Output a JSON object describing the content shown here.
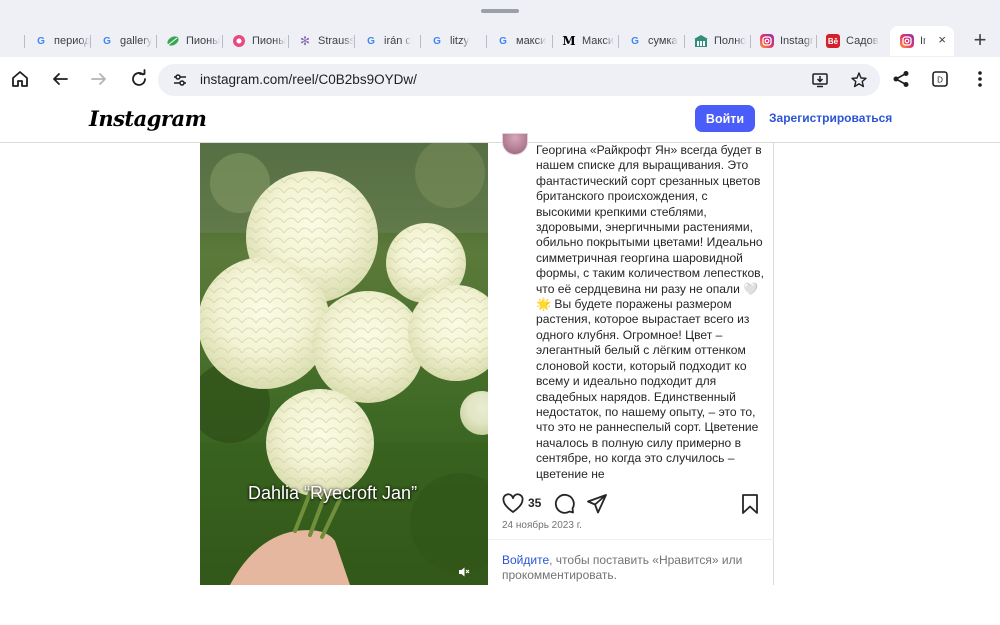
{
  "browser": {
    "tabs": [
      {
        "title": "периоди",
        "favicon": "google-icon"
      },
      {
        "title": "gallery",
        "favicon": "google-icon"
      },
      {
        "title": "Пионы",
        "favicon": "leaf-icon"
      },
      {
        "title": "Пионы",
        "favicon": "pink-flower-icon"
      },
      {
        "title": "Strauss",
        "favicon": "snowflake-icon"
      },
      {
        "title": "irán c",
        "favicon": "google-icon"
      },
      {
        "title": "litzy",
        "favicon": "google-icon"
      },
      {
        "title": "макси",
        "favicon": "google-icon"
      },
      {
        "title": "Макси",
        "favicon": "m-letter-icon"
      },
      {
        "title": "сумка",
        "favicon": "google-icon"
      },
      {
        "title": "Полно",
        "favicon": "building-icon"
      },
      {
        "title": "Instagr",
        "favicon": "instagram-icon"
      },
      {
        "title": "Садов",
        "favicon": "behance-icon"
      },
      {
        "title": "Ins",
        "favicon": "instagram-icon"
      }
    ],
    "active_tab_index": 13,
    "new_tab_label": "+",
    "close_tab_label": "×",
    "url": "instagram.com/reel/C0B2bs9OYDw/"
  },
  "instagram": {
    "logo": "Instagram",
    "login_label": "Войти",
    "signup_label": "Зарегистрироваться",
    "video_caption": "Dahlia “Ryecroft Jan”",
    "post_caption": "Георгина «Райкрофт Ян» всегда будет в нашем списке для выращивания. Это фантастический сорт срезанных цветов британского происхождения, с высокими крепкими стеблями, здоровыми, энергичными растениями, обильно покрытыми цветами! Идеально симметричная георгина шаровидной формы, с таким количеством лепестков, что её сердцевина ни разу не опали 🤍🌟 Вы будете поражены размером растения, которое вырастает всего из одного клубня. Огромное! Цвет – элегантный белый с лёгким оттенком слоновой кости, который подходит ко всему и идеально подходит для свадебных нарядов. Единственный недостаток, по нашему опыту, – это то, что это не раннеспелый сорт. Цветение началось в полную силу примерно в сентябре, но когда это случилось – цветение не",
    "likes_count": "35",
    "post_date": "24 ноябрь 2023 г.",
    "login_prompt_link": "Войдите",
    "login_prompt_text": ", чтобы поставить «Нравится» или прокомментировать."
  },
  "colors": {
    "chrome_bg": "#eef0f6",
    "login_button": "#4a5df9",
    "link_blue": "#2b54d6"
  }
}
